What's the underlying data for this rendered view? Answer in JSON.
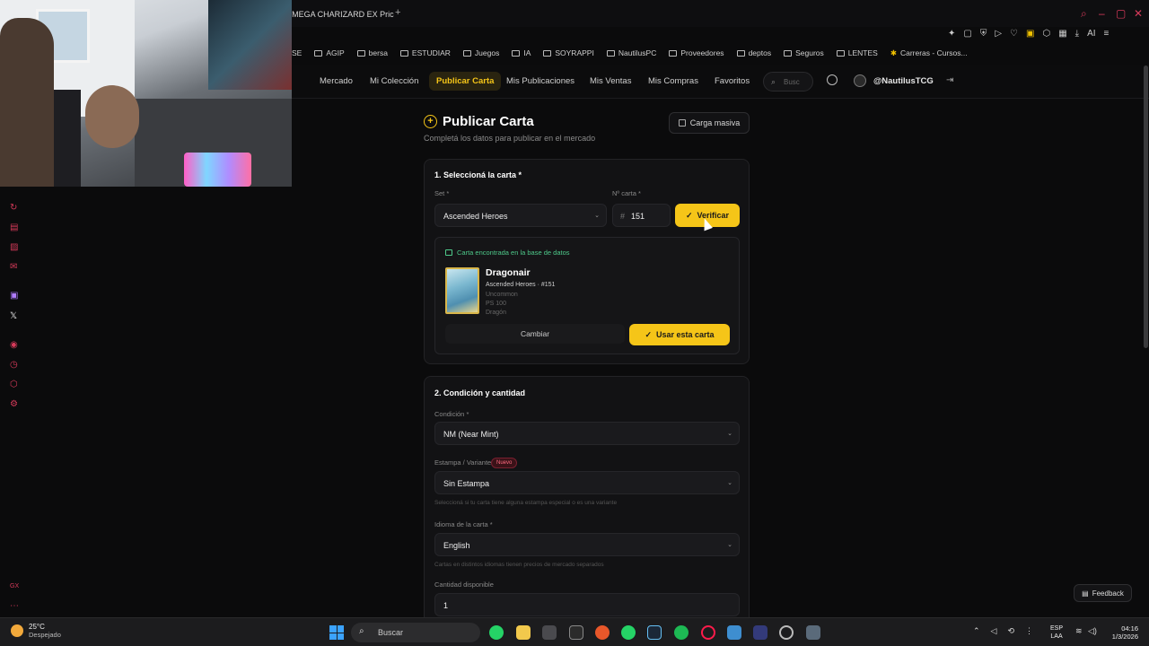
{
  "browser": {
    "tab_title": "MEGA CHARIZARD EX Pric",
    "new_tab": "+",
    "bookmarks": [
      "AGIP",
      "bersa",
      "ESTUDIAR",
      "Juegos",
      "IA",
      "SOYRAPPI",
      "NautilusPC",
      "Proveedores",
      "deptos",
      "Seguros",
      "LENTES",
      "Carreras - Cursos..."
    ],
    "bookmark_prefix": "SE",
    "ai_label": "AI"
  },
  "nav": {
    "items": [
      "Mercado",
      "Mi Colección",
      "Publicar Carta",
      "Mis Publicaciones",
      "Mis Ventas",
      "Mis Compras",
      "Favoritos"
    ],
    "active": "Publicar Carta",
    "search_placeholder": "Busc",
    "username": "@NautilusTCG"
  },
  "page": {
    "title": "Publicar Carta",
    "subtitle": "Completá los datos para publicar en el mercado",
    "bulk_button": "Carga masiva"
  },
  "section1": {
    "title": "1. Seleccioná la carta *",
    "set_label": "Set *",
    "set_value": "Ascended Heroes",
    "number_label": "Nº carta *",
    "number_value": "151",
    "verify_button": "Verificar",
    "found_text": "Carta encontrada en la base de datos",
    "card_name": "Dragonair",
    "card_set": "Ascended Heroes · #151",
    "card_rarity": "Uncommon",
    "card_hp": "PS 100",
    "card_type": "Dragón",
    "change_button": "Cambiar",
    "use_button": "Usar esta carta"
  },
  "section2": {
    "title": "2. Condición y cantidad",
    "condition_label": "Condición *",
    "condition_value": "NM (Near Mint)",
    "stamp_label": "Estampa / Variante",
    "stamp_badge": "Nuevo",
    "stamp_value": "Sin Estampa",
    "stamp_hint": "Seleccioná si tu carta tiene alguna estampa especial o es una variante",
    "language_label": "Idioma de la carta *",
    "language_value": "English",
    "language_hint": "Cartas en distintos idiomas tienen precios de mercado separados",
    "quantity_label": "Cantidad disponible",
    "quantity_value": "1"
  },
  "feedback_button": "Feedback",
  "taskbar": {
    "temperature": "25°C",
    "weather": "Despejado",
    "search": "Buscar",
    "lang_line1": "ESP",
    "lang_line2": "LAA",
    "time": "04:16",
    "date": "1/3/2026"
  },
  "colors": {
    "accent": "#f5c518",
    "success": "#4ec98a",
    "background": "#0b0b0c"
  }
}
